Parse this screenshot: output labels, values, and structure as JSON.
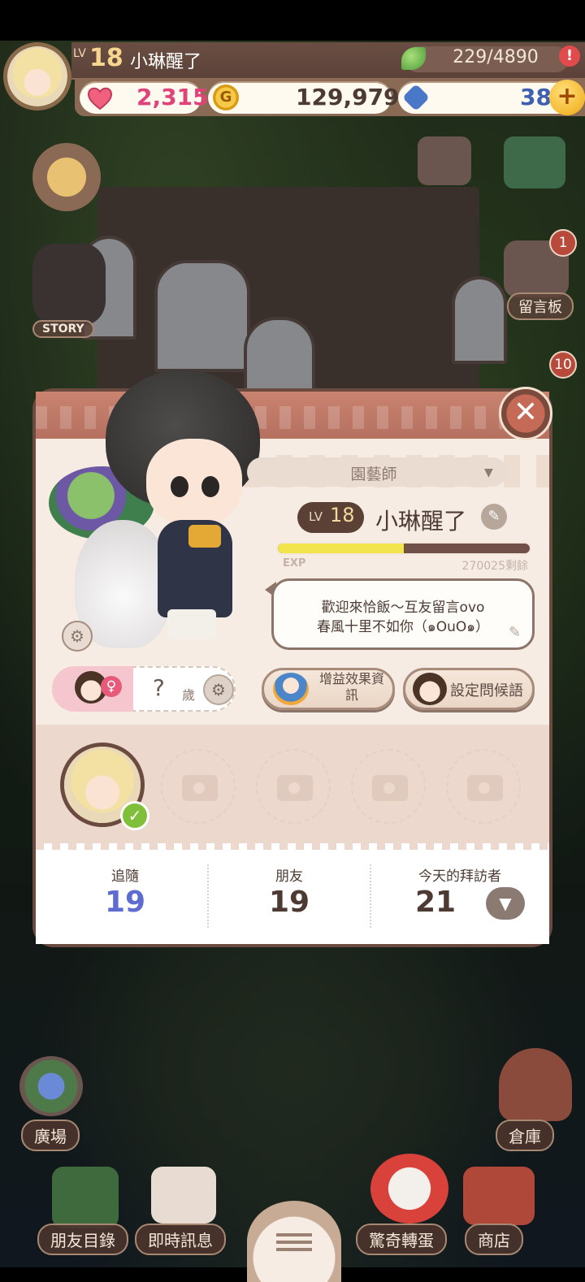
{
  "hud": {
    "lv_label": "LV",
    "level": "18",
    "player_name": "小琳醒了",
    "energy": "229/4890",
    "alert_icon": "!",
    "hearts": "2,315",
    "coins": "129,979",
    "gems": "38",
    "plus": "+",
    "coin_glyph": "G"
  },
  "scene": {
    "story_label": "STORY",
    "message_board_label": "留言板",
    "message_board_badge": "1",
    "gift_badge": "10",
    "plaza_label": "廣場",
    "warehouse_label": "倉庫"
  },
  "profile": {
    "close_glyph": "✕",
    "title": "園藝師",
    "lv_label": "LV",
    "level": "18",
    "name": "小琳醒了",
    "exp_label": "EXP",
    "exp_remaining": "270025剩餘",
    "exp_progress": 0.5,
    "greeting_line1": "歡迎來恰飯～互友留言ovo",
    "greeting_line2": "春風十里不如你（๑OuO๑）",
    "age_value": "?",
    "age_unit": "歲",
    "gender_symbol": "♀",
    "buff_button": "增益效果資訊",
    "greeting_button": "設定問候語",
    "check_glyph": "✓",
    "photo_slots": 4
  },
  "stats": {
    "follow_label": "追隨",
    "follow_value": "19",
    "friends_label": "朋友",
    "friends_value": "19",
    "visitors_label": "今天的拜訪者",
    "visitors_value": "21"
  },
  "nav": {
    "friends_list": "朋友目錄",
    "chat": "即時訊息",
    "gacha": "驚奇轉蛋",
    "shop": "商店"
  },
  "colors": {
    "follow_number": "#5e6bd0",
    "heart_text": "#e0427a",
    "brown_text": "#4c3a33",
    "gem_text": "#3f5fb0"
  }
}
